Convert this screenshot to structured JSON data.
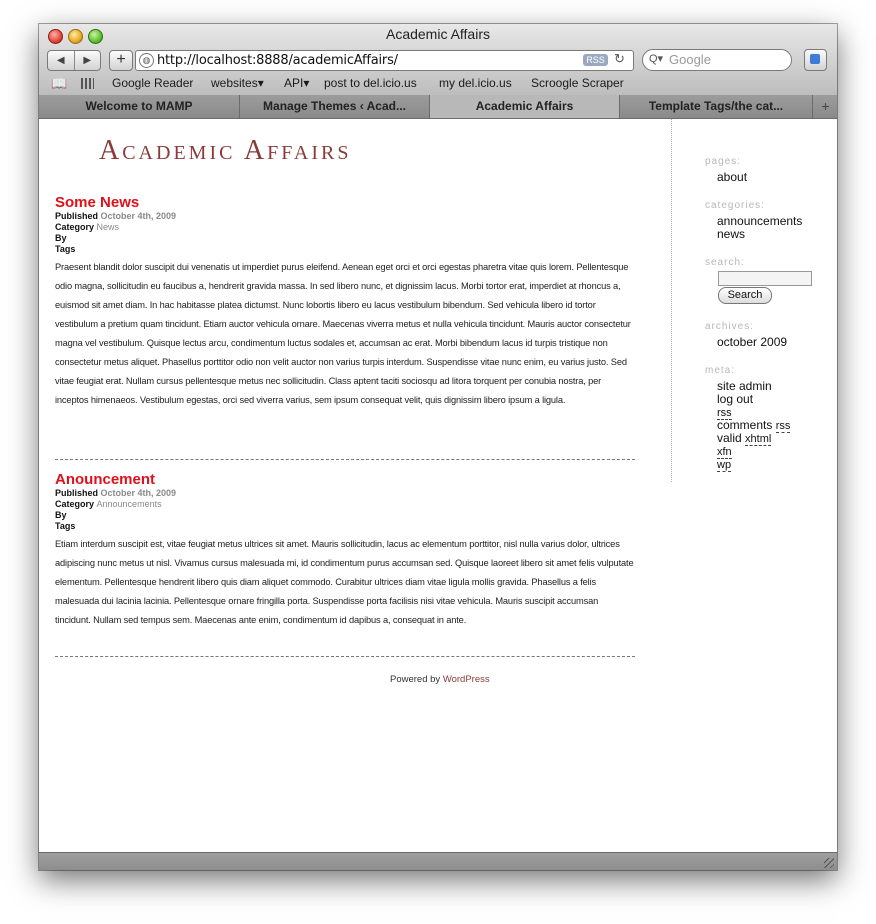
{
  "window": {
    "title": "Academic Affairs"
  },
  "toolbar": {
    "back_icon": "back-arrow-icon",
    "forward_icon": "forward-arrow-icon",
    "add_label": "+",
    "url": "http://localhost:8888/academicAffairs/",
    "rss_label": "RSS",
    "search_placeholder": "Google"
  },
  "bookmarks": [
    "Google Reader",
    "websites▾",
    "API▾",
    "post to del.icio.us",
    "my del.icio.us",
    "Scroogle Scraper"
  ],
  "tabs": [
    {
      "label": "Welcome to MAMP",
      "active": false
    },
    {
      "label": "Manage Themes ‹ Acad...",
      "active": false
    },
    {
      "label": "Academic Affairs",
      "active": true
    },
    {
      "label": "Template Tags/the cat...",
      "active": false
    }
  ],
  "tab_plus": "+",
  "site": {
    "title": "Academic Affairs"
  },
  "posts": [
    {
      "title": "Some News",
      "published_label": "Published",
      "date": "October 4th, 2009",
      "category_label": "Category",
      "category": "News",
      "by_label": "By",
      "tags_label": "Tags",
      "body": "Praesent blandit dolor suscipit dui venenatis ut imperdiet purus eleifend. Aenean eget orci et orci egestas pharetra vitae quis lorem. Pellentesque odio magna, sollicitudin eu faucibus a, hendrerit gravida massa. In sed libero nunc, et dignissim lacus. Morbi tortor erat, imperdiet at rhoncus a, euismod sit amet diam. In hac habitasse platea dictumst. Nunc lobortis libero eu lacus vestibulum bibendum. Sed vehicula libero id tortor vestibulum a pretium quam tincidunt. Etiam auctor vehicula ornare. Maecenas viverra metus et nulla vehicula tincidunt. Mauris auctor consectetur magna vel vestibulum. Quisque lectus arcu, condimentum luctus sodales et, accumsan ac erat. Morbi bibendum lacus id turpis tristique non consectetur metus aliquet. Phasellus porttitor odio non velit auctor non varius turpis interdum. Suspendisse vitae nunc enim, eu varius justo. Sed vitae feugiat erat. Nullam cursus pellentesque metus nec sollicitudin. Class aptent taciti sociosqu ad litora torquent per conubia nostra, per inceptos himenaeos. Vestibulum egestas, orci sed viverra varius, sem ipsum consequat velit, quis dignissim libero ipsum a ligula."
    },
    {
      "title": "Anouncement",
      "published_label": "Published",
      "date": "October 4th, 2009",
      "category_label": "Category",
      "category": "Announcements",
      "by_label": "By",
      "tags_label": "Tags",
      "body": "Etiam interdum suscipit est, vitae feugiat metus ultrices sit amet. Mauris sollicitudin, lacus ac elementum porttitor, nisl nulla varius dolor, ultrices adipiscing nunc metus ut nisl. Vivamus cursus malesuada mi, id condimentum purus accumsan sed. Quisque laoreet libero sit amet felis vulputate elementum. Pellentesque hendrerit libero quis diam aliquet commodo. Curabitur ultrices diam vitae ligula mollis gravida. Phasellus a felis malesuada dui lacinia lacinia. Pellentesque ornare fringilla porta. Suspendisse porta facilisis nisi vitae vehicula. Mauris suscipit accumsan tincidunt. Nullam sed tempus sem. Maecenas ante enim, condimentum id dapibus a, consequat in ante."
    }
  ],
  "footer": {
    "powered_by": "Powered by",
    "wordpress": "WordPress"
  },
  "sidebar": {
    "pages_heading": "pages:",
    "pages": [
      "about"
    ],
    "categories_heading": "categories:",
    "categories": [
      "announcements",
      "news"
    ],
    "search_heading": "search:",
    "search_button": "Search",
    "archives_heading": "archives:",
    "archives": [
      "october 2009"
    ],
    "meta_heading": "meta:",
    "meta_site_admin": "site admin",
    "meta_log_out": "log out",
    "meta_rss": "rss",
    "meta_comments": "comments",
    "meta_comments_rss": "rss",
    "meta_valid": "valid",
    "meta_xhtml": "xhtml",
    "meta_xfn": "xfn",
    "meta_wp": "wp"
  },
  "colors": {
    "site_title": "#8b3a3a",
    "post_title": "#e0101a",
    "link": "#8b3a3a"
  }
}
